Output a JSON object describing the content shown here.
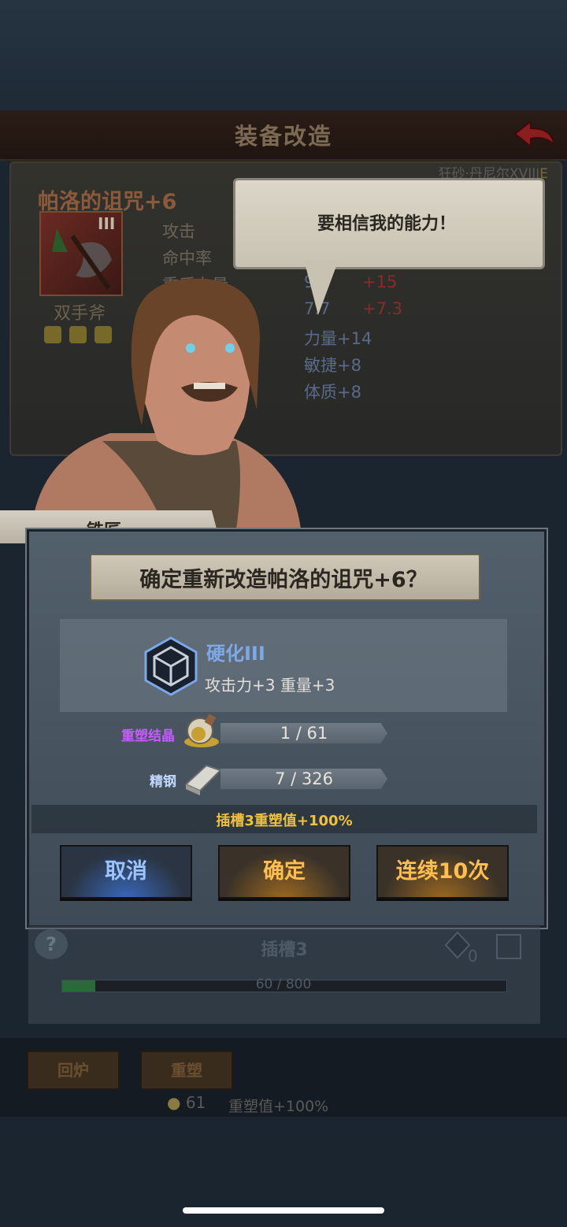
{
  "header": {
    "title": "装备改造"
  },
  "item": {
    "owner": "狂砂·丹尼尔XVIII",
    "owner_suffix": "E",
    "name": "帕洛的诅咒+6",
    "tier": "III",
    "type": "双手斧",
    "stats": [
      {
        "label": "攻击",
        "value": "",
        "bonus": ""
      },
      {
        "label": "命中率",
        "value": "",
        "bonus": ""
      },
      {
        "label": "重盾力量",
        "value": "9",
        "bonus": "+15"
      },
      {
        "label": "",
        "value": "7.7",
        "bonus": "+7.3"
      }
    ],
    "attributes": [
      "力量+14",
      "敏捷+8",
      "体质+8"
    ]
  },
  "speech": {
    "text": "要相信我的能力！"
  },
  "npc": {
    "name": "铁匠"
  },
  "dialog": {
    "question": "确定重新改造帕洛的诅咒+6？",
    "effect_name": "硬化III",
    "effect_desc": "攻击力+3 重量+3",
    "resources": [
      {
        "name": "重塑结晶",
        "amount": "1 / 61",
        "color": "#c45cff",
        "icon": "potion-flask-icon"
      },
      {
        "name": "精钢",
        "amount": "7 / 326",
        "color": "#c0d8ff",
        "icon": "steel-ingot-icon"
      }
    ],
    "bonus": "插槽3重塑值+100%",
    "buttons": {
      "cancel": "取消",
      "confirm": "确定",
      "ten": "连续10次"
    }
  },
  "slot": {
    "help": "?",
    "title": "插槽3",
    "count": "0",
    "progress_text": "60 / 800",
    "progress_fraction": 0.075
  },
  "bottom": {
    "recycle": "回炉",
    "reshape": "重塑",
    "crystal_count": "61",
    "reshape_value": "重塑值+100%"
  }
}
